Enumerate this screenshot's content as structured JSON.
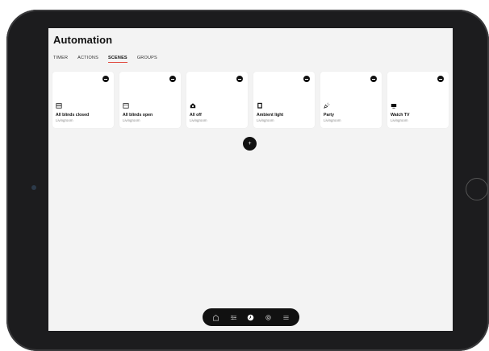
{
  "app": {
    "title": "Automation"
  },
  "tabs": [
    {
      "label": "TIMER",
      "active": false
    },
    {
      "label": "ACTIONS",
      "active": false
    },
    {
      "label": "SCENES",
      "active": true
    },
    {
      "label": "GROUPS",
      "active": false
    }
  ],
  "scenes": [
    {
      "name": "All blinds closed",
      "room": "Livingroom",
      "icon": "blinds-closed-icon"
    },
    {
      "name": "All blinds open",
      "room": "Livingroom",
      "icon": "blinds-open-icon"
    },
    {
      "name": "All off",
      "room": "Livingroom",
      "icon": "home-off-icon"
    },
    {
      "name": "Ambient light",
      "room": "Livingroom",
      "icon": "door-light-icon"
    },
    {
      "name": "Party",
      "room": "Livingroom",
      "icon": "party-icon"
    },
    {
      "name": "Watch TV",
      "room": "Livingroom",
      "icon": "tv-icon"
    }
  ],
  "add_button": {
    "label": "+"
  },
  "nav": [
    {
      "icon": "home-icon",
      "active": false
    },
    {
      "icon": "sliders-icon",
      "active": false
    },
    {
      "icon": "clock-icon",
      "active": true
    },
    {
      "icon": "settings-icon",
      "active": false
    },
    {
      "icon": "menu-icon",
      "active": false
    }
  ],
  "colors": {
    "accent": "#e04a3f",
    "screen_bg": "#f3f3f3",
    "card_bg": "#ffffff",
    "dark": "#111111"
  }
}
